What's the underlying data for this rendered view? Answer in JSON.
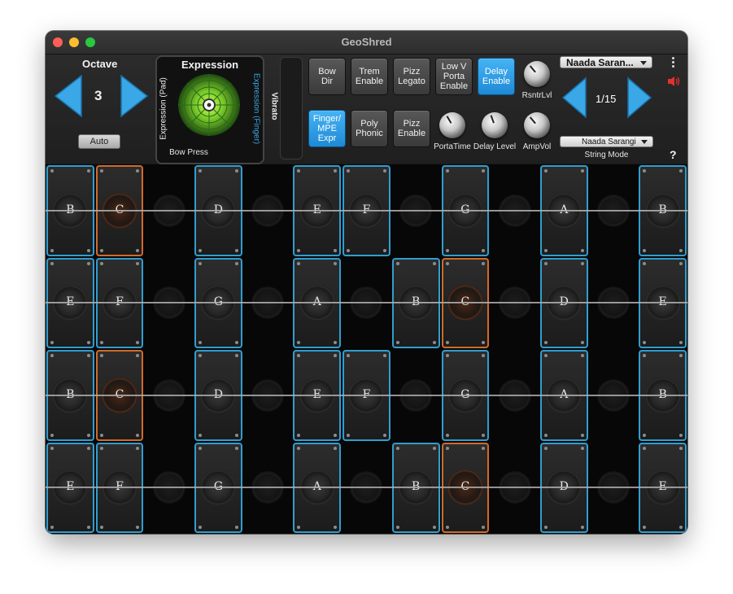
{
  "window": {
    "title": "GeoShred"
  },
  "octave": {
    "label": "Octave",
    "value": "3",
    "auto_label": "Auto"
  },
  "expression": {
    "title": "Expression",
    "left_label": "Expression (Pad)",
    "right_label": "Expression (Finger)",
    "bottom_label": "Bow Press",
    "vibrato_label": "Vibrato"
  },
  "controls": {
    "tiles": [
      {
        "label": "Bow\nDir",
        "on": false
      },
      {
        "label": "Trem\nEnable",
        "on": false
      },
      {
        "label": "Pizz\nLegato",
        "on": false
      },
      {
        "label": "Low V\nPorta\nEnable",
        "on": false
      },
      {
        "label": "Delay\nEnable",
        "on": true
      },
      {
        "label": "Finger/\nMPE\nExpr",
        "on": true
      },
      {
        "label": "Poly\nPhonic",
        "on": false
      },
      {
        "label": "Pizz\nEnable",
        "on": false
      }
    ],
    "knobs": [
      "RsntrLvl",
      "PortaTime",
      "Delay Level",
      "AmpVol"
    ]
  },
  "preset": {
    "name": "Naada Saran...",
    "page": "1/15",
    "mode_value": "Naada Sarangi",
    "mode_label": "String Mode"
  },
  "icons": {
    "menu": "vertical-dots-icon",
    "audio": "speaker-icon",
    "help": "?"
  },
  "colors": {
    "blue": "#2f9ed0",
    "orange": "#d26a2a",
    "accent_on": "#2a97e0"
  },
  "grid": {
    "columns": 13,
    "rows": [
      {
        "cells": [
          {
            "note": "B",
            "state": "blue"
          },
          {
            "note": "C",
            "state": "orange"
          },
          {
            "note": "",
            "state": "dark"
          },
          {
            "note": "D",
            "state": "blue"
          },
          {
            "note": "",
            "state": "dark"
          },
          {
            "note": "E",
            "state": "blue"
          },
          {
            "note": "F",
            "state": "blue"
          },
          {
            "note": "",
            "state": "dark"
          },
          {
            "note": "G",
            "state": "blue"
          },
          {
            "note": "",
            "state": "dark"
          },
          {
            "note": "A",
            "state": "blue"
          },
          {
            "note": "",
            "state": "dark"
          },
          {
            "note": "B",
            "state": "blue"
          }
        ]
      },
      {
        "cells": [
          {
            "note": "E",
            "state": "blue"
          },
          {
            "note": "F",
            "state": "blue"
          },
          {
            "note": "",
            "state": "dark"
          },
          {
            "note": "G",
            "state": "blue"
          },
          {
            "note": "",
            "state": "dark"
          },
          {
            "note": "A",
            "state": "blue"
          },
          {
            "note": "",
            "state": "dark"
          },
          {
            "note": "B",
            "state": "blue"
          },
          {
            "note": "C",
            "state": "orange"
          },
          {
            "note": "",
            "state": "dark"
          },
          {
            "note": "D",
            "state": "blue"
          },
          {
            "note": "",
            "state": "dark"
          },
          {
            "note": "E",
            "state": "blue"
          }
        ]
      },
      {
        "cells": [
          {
            "note": "B",
            "state": "blue"
          },
          {
            "note": "C",
            "state": "orange"
          },
          {
            "note": "",
            "state": "dark"
          },
          {
            "note": "D",
            "state": "blue"
          },
          {
            "note": "",
            "state": "dark"
          },
          {
            "note": "E",
            "state": "blue"
          },
          {
            "note": "F",
            "state": "blue"
          },
          {
            "note": "",
            "state": "dark"
          },
          {
            "note": "G",
            "state": "blue"
          },
          {
            "note": "",
            "state": "dark"
          },
          {
            "note": "A",
            "state": "blue"
          },
          {
            "note": "",
            "state": "dark"
          },
          {
            "note": "B",
            "state": "blue"
          }
        ]
      },
      {
        "cells": [
          {
            "note": "E",
            "state": "blue"
          },
          {
            "note": "F",
            "state": "blue"
          },
          {
            "note": "",
            "state": "dark"
          },
          {
            "note": "G",
            "state": "blue"
          },
          {
            "note": "",
            "state": "dark"
          },
          {
            "note": "A",
            "state": "blue"
          },
          {
            "note": "",
            "state": "dark"
          },
          {
            "note": "B",
            "state": "blue"
          },
          {
            "note": "C",
            "state": "orange"
          },
          {
            "note": "",
            "state": "dark"
          },
          {
            "note": "D",
            "state": "blue"
          },
          {
            "note": "",
            "state": "dark"
          },
          {
            "note": "E",
            "state": "blue"
          }
        ]
      }
    ]
  }
}
